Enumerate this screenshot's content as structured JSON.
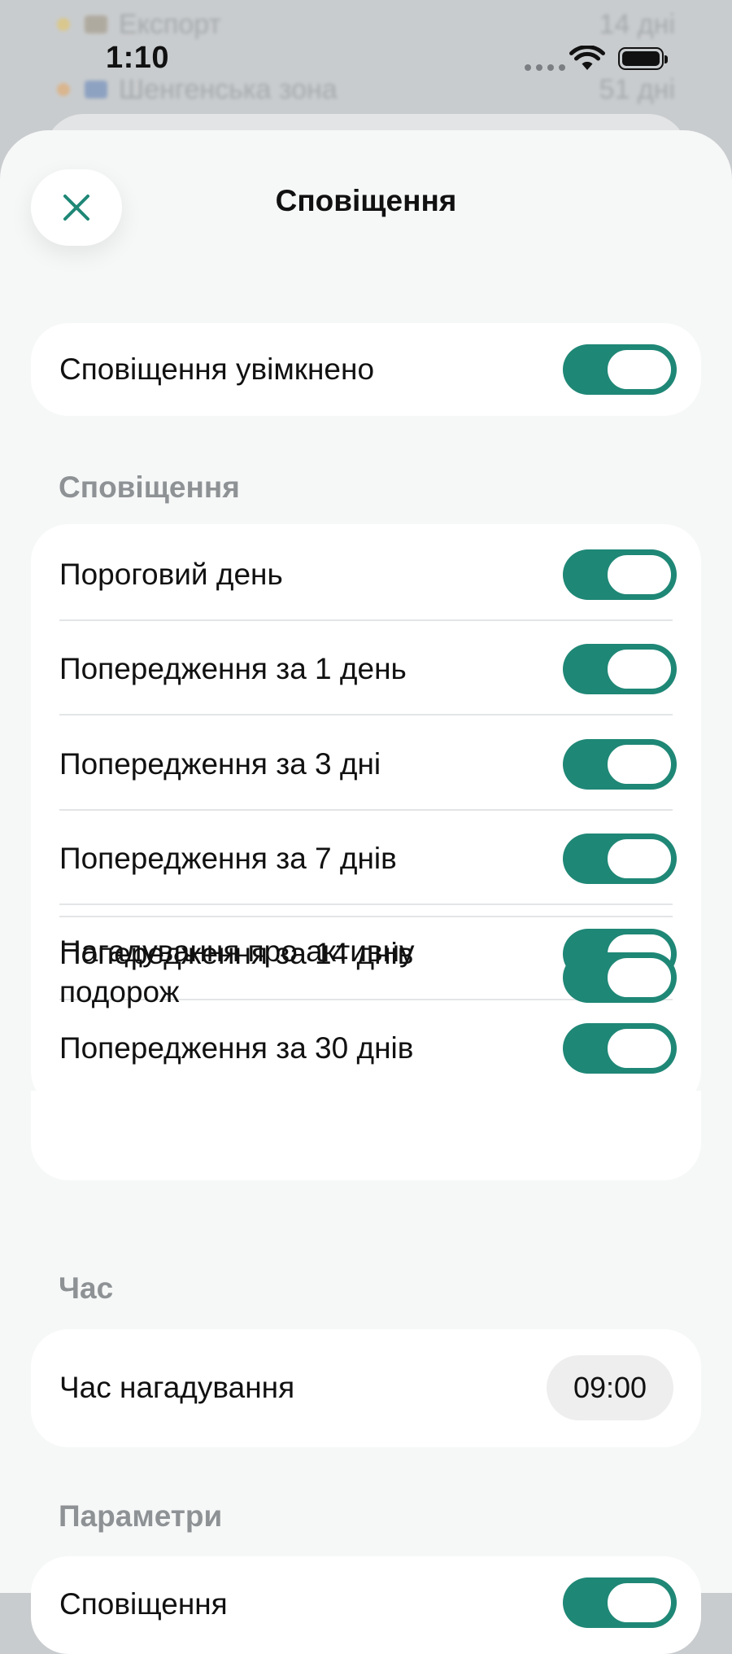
{
  "status_bar": {
    "time": "1:10"
  },
  "background_app": {
    "rows": [
      {
        "label": "Експорт",
        "right": "14 дні"
      },
      {
        "label": "Шенгенська зона",
        "right": "51 дні"
      }
    ]
  },
  "header": {
    "title": "Сповіщення",
    "close_icon": "close-icon"
  },
  "master": {
    "label": "Сповіщення увімкнено",
    "enabled": true
  },
  "notifications_section": {
    "title": "Сповіщення",
    "items": [
      {
        "label": "Пороговий день",
        "enabled": true
      },
      {
        "label": "Попередження за 1 день",
        "enabled": true
      },
      {
        "label": "Попередження за 3 дні",
        "enabled": true
      },
      {
        "label": "Попередження за 7 днів",
        "enabled": true
      },
      {
        "label": "Попередження за 14 днів",
        "enabled": true
      },
      {
        "label": "Попередження за 30 днів",
        "enabled": true
      },
      {
        "label": "Нагадування про активну подорож",
        "enabled": true
      }
    ]
  },
  "time_section": {
    "title": "Час",
    "reminder_label": "Час нагадування",
    "reminder_value": "09:00"
  },
  "params_section": {
    "title": "Параметри",
    "first_item_label": "Сповіщення",
    "first_item_enabled": true
  },
  "colors": {
    "accent": "#1f8776",
    "sheet_background": "#f6f7f7",
    "section_header": "#8e9295"
  }
}
